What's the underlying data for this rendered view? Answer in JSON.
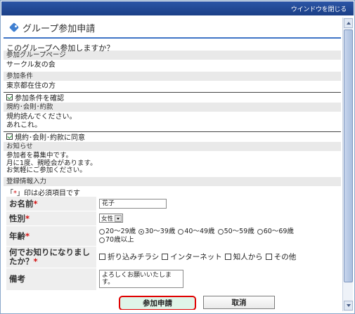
{
  "window": {
    "close_label": "ウインドウを閉じる"
  },
  "page": {
    "title": "グループ参加申請",
    "question": "このグループへ参加しますか？"
  },
  "sections": {
    "group_page_label": "参加グループページ",
    "group_page_value": "サークル友の会",
    "conditions_label": "参加条件",
    "conditions_value": "東京都在住の方",
    "conditions_check": "参加条件を確認",
    "rules_label": "規約･会則･約款",
    "rules_line1": "規約読んでください。",
    "rules_line2": "あれこれ。",
    "rules_check": "規約･会則･約款に同意",
    "notice_label": "お知らせ",
    "notice_line1": "参加者を募集中です。",
    "notice_line2": "月に1度、親睦会があります。",
    "notice_line3": "お気軽にご参加ください。",
    "registration_label": "登録情報入力"
  },
  "required_note": {
    "prefix": "「",
    "star": "*",
    "suffix": "」印は必須項目です"
  },
  "form": {
    "name_label": "お名前",
    "name_value": "花子",
    "gender_label": "性別",
    "gender_value": "女性",
    "age_label": "年齢",
    "age_options": [
      "20～29歳",
      "30～39歳",
      "40～49歳",
      "50～59歳",
      "60～69歳",
      "70歳以上"
    ],
    "age_selected": "30～39歳",
    "source_label": "何でお知りになりましたか？",
    "source_options": [
      "折り込みチラシ",
      "インターネット",
      "知人から",
      "その他"
    ],
    "remarks_label": "備考",
    "remarks_value": "よろしくお願いいたします。",
    "required_star": "*"
  },
  "buttons": {
    "submit": "参加申請",
    "cancel": "取消"
  },
  "colors": {
    "topbar": "#1b3f86",
    "accent": "#3f74c6",
    "required": "#d21010",
    "submit_border": "#e00000",
    "submit_fill": "#dff4e8"
  }
}
